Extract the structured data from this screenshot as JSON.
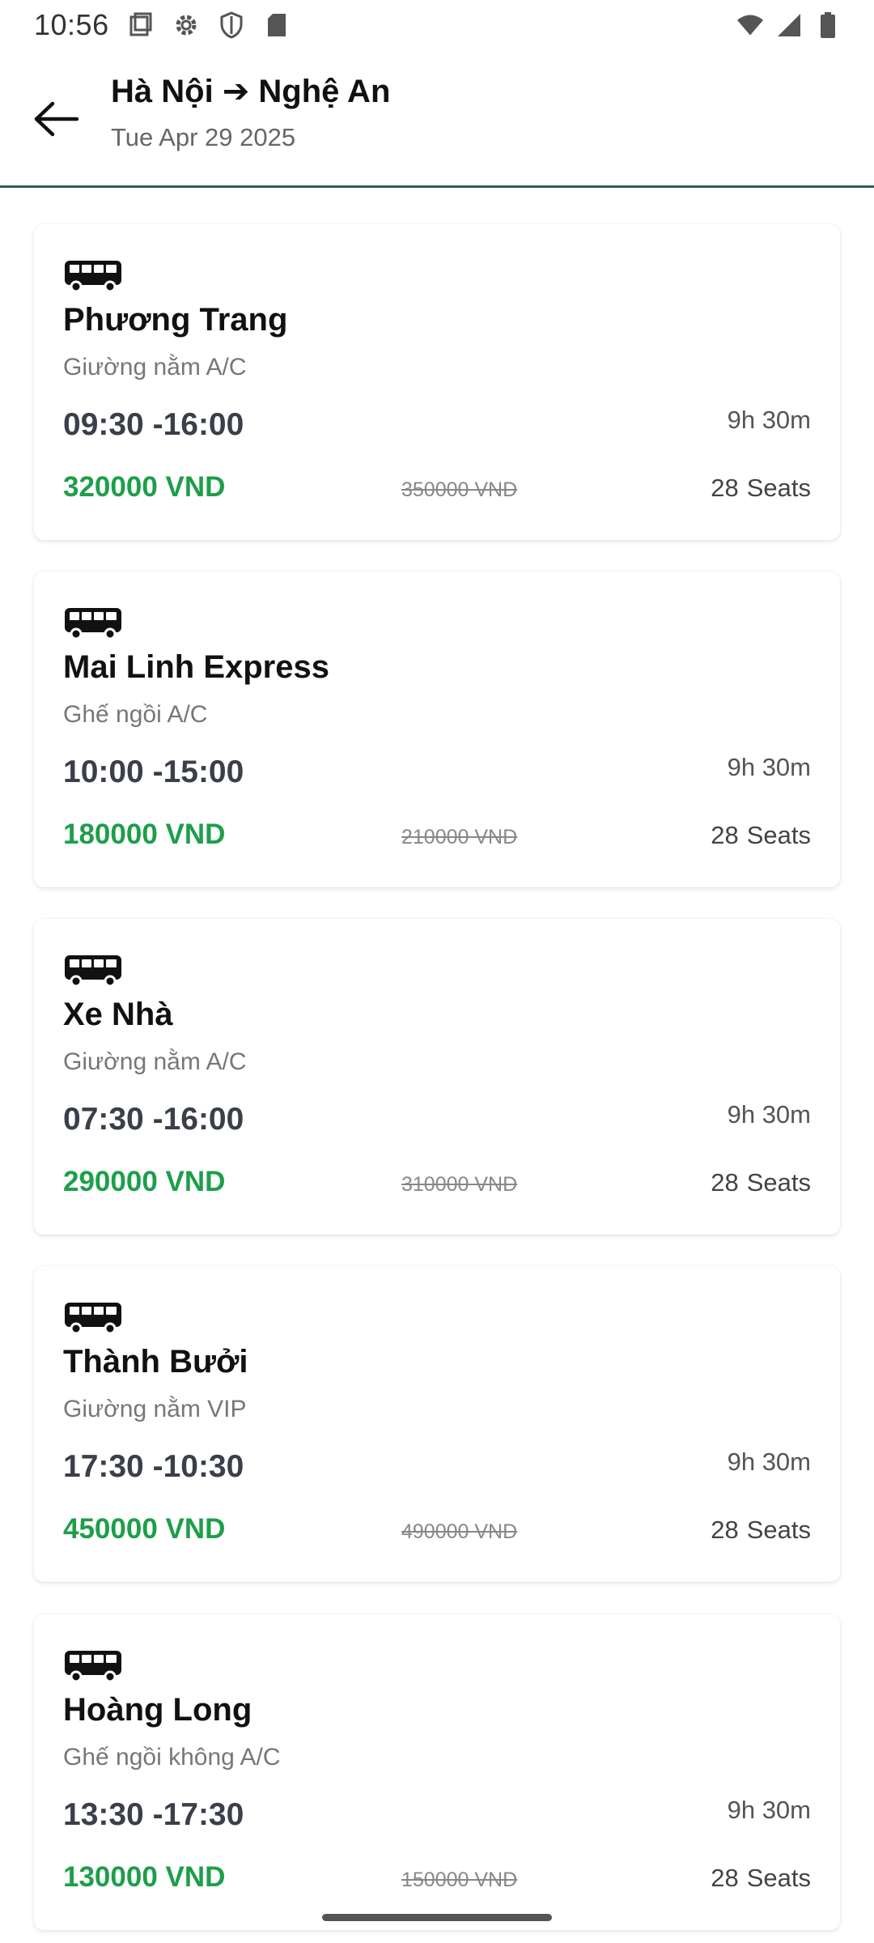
{
  "status_bar": {
    "time": "10:56",
    "icons": [
      "screen-icon",
      "gear-icon",
      "shield-icon",
      "sd-card-icon"
    ],
    "right_icons": [
      "wifi-icon",
      "signal-icon",
      "battery-icon"
    ]
  },
  "header": {
    "title": "Hà Nội ➔ Nghệ An",
    "date": "Tue Apr 29 2025",
    "accent_color": "#2f5f57"
  },
  "trips": [
    {
      "operator": "Phương Trang",
      "seat_type": "Giường nằm A/C",
      "time": "09:30 -16:00",
      "duration": "9h 30m",
      "price": "320000 VND",
      "old_price": "350000 VND",
      "seats_count": "28",
      "seats_label": "Seats"
    },
    {
      "operator": "Mai Linh Express",
      "seat_type": "Ghế ngồi A/C",
      "time": "10:00 -15:00",
      "duration": "9h 30m",
      "price": "180000 VND",
      "old_price": "210000 VND",
      "seats_count": "28",
      "seats_label": "Seats"
    },
    {
      "operator": "Xe Nhà",
      "seat_type": "Giường nằm A/C",
      "time": "07:30 -16:00",
      "duration": "9h 30m",
      "price": "290000 VND",
      "old_price": "310000 VND",
      "seats_count": "28",
      "seats_label": "Seats"
    },
    {
      "operator": "Thành Bưởi",
      "seat_type": "Giường nằm VIP",
      "time": "17:30 -10:30",
      "duration": "9h 30m",
      "price": "450000 VND",
      "old_price": "490000 VND",
      "seats_count": "28",
      "seats_label": "Seats"
    },
    {
      "operator": "Hoàng Long",
      "seat_type": "Ghế ngồi không A/C",
      "time": "13:30 -17:30",
      "duration": "9h 30m",
      "price": "130000 VND",
      "old_price": "150000 VND",
      "seats_count": "28",
      "seats_label": "Seats"
    }
  ],
  "colors": {
    "price": "#1e9e4a",
    "divider": "#2f5f57"
  }
}
